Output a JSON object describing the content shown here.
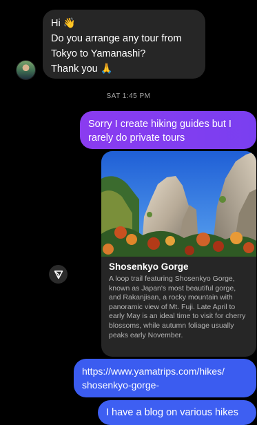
{
  "incoming": {
    "line1": "Hi 👋",
    "line2": "Do you arrange any tour from",
    "line3": "Tokyo to Yamanashi?",
    "line4": "Thank you 🙏"
  },
  "timestamp": "SAT 1:45 PM",
  "outgoing_reply": "Sorry I create hiking guides but I rarely do private tours",
  "link_card": {
    "title": "Shosenkyo Gorge",
    "description": "A loop trail featuring Shosenkyo Gorge, known as Japan's most beautiful gorge, and Rakanjisan, a rocky mountain with panoramic view of Mt. Fuji. Late April to early May is an ideal time to visit for cherry blossoms, while autumn foliage usually peaks early November."
  },
  "link_message": {
    "line1": "https://www.yamatrips.com/hikes/",
    "line2": "shosenkyo-gorge-"
  },
  "last_message": "I have a blog on various hikes",
  "icons": {
    "avatar": "user-avatar",
    "share": "share-icon"
  },
  "colors": {
    "background": "#000000",
    "incoming_bubble": "#262626",
    "outgoing_purple": "#8a3cf0",
    "outgoing_blue": "#3b5cf0"
  }
}
